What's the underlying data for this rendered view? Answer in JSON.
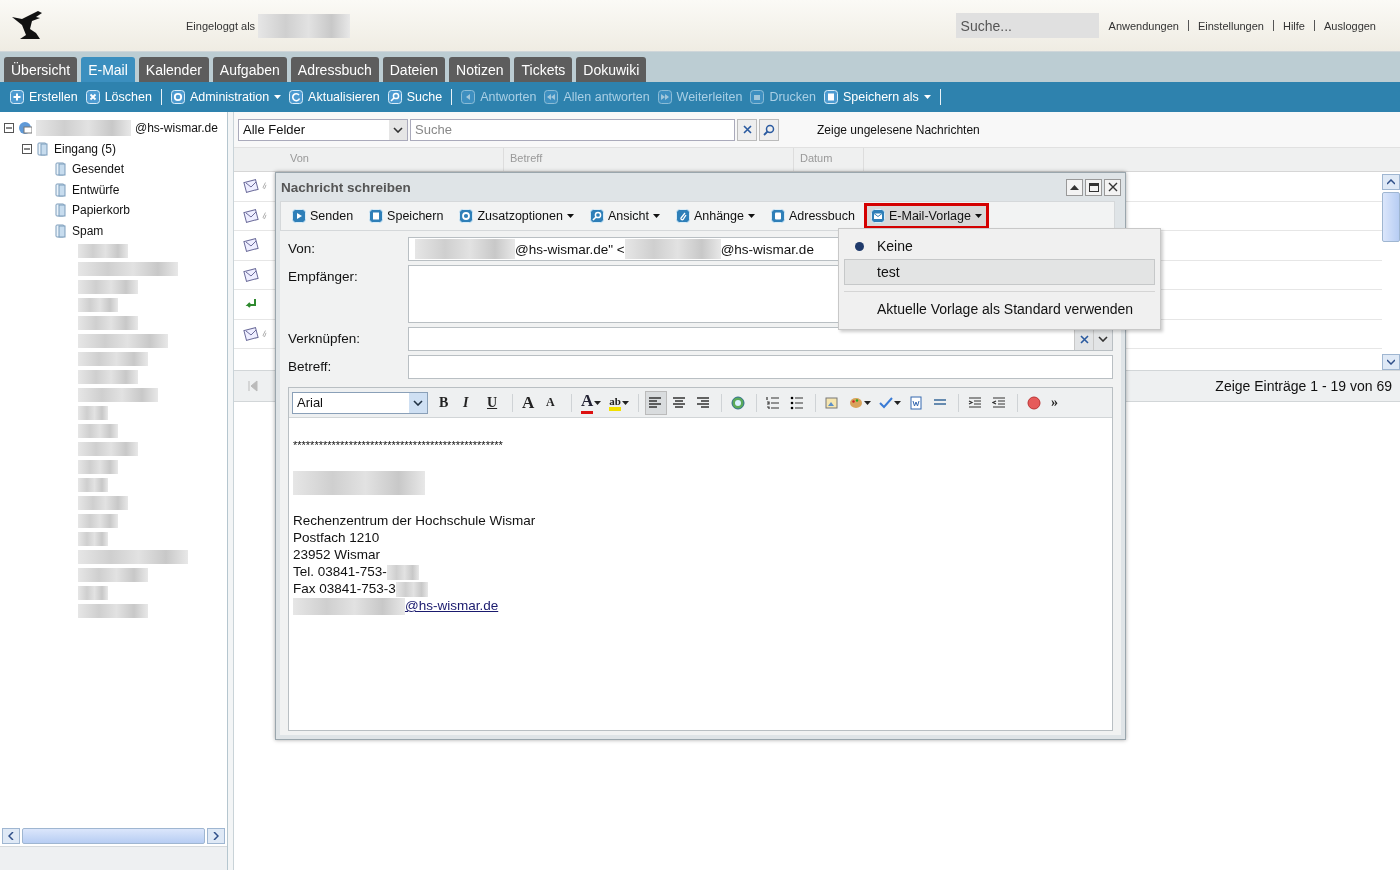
{
  "header": {
    "logged_in_label": "Eingeloggt als",
    "search": {
      "placeholder": "Suche..."
    },
    "links": [
      "Anwendungen",
      "Einstellungen",
      "Hilfe",
      "Ausloggen"
    ]
  },
  "tabs": [
    {
      "label": "Übersicht",
      "selected": false
    },
    {
      "label": "E-Mail",
      "selected": true
    },
    {
      "label": "Kalender",
      "selected": false
    },
    {
      "label": "Aufgaben",
      "selected": false
    },
    {
      "label": "Adressbuch",
      "selected": false
    },
    {
      "label": "Dateien",
      "selected": false
    },
    {
      "label": "Notizen",
      "selected": false
    },
    {
      "label": "Tickets",
      "selected": false
    },
    {
      "label": "Dokuwiki",
      "selected": false
    }
  ],
  "toolbar": {
    "groups": [
      [
        {
          "label": "Erstellen",
          "disabled": false,
          "dropdown": false
        },
        {
          "label": "Löschen",
          "disabled": false,
          "dropdown": false
        }
      ],
      [
        {
          "label": "Administration",
          "disabled": false,
          "dropdown": true
        },
        {
          "label": "Aktualisieren",
          "disabled": false,
          "dropdown": false
        },
        {
          "label": "Suche",
          "disabled": false,
          "dropdown": false
        }
      ],
      [
        {
          "label": "Antworten",
          "disabled": true,
          "dropdown": false
        },
        {
          "label": "Allen antworten",
          "disabled": true,
          "dropdown": false
        },
        {
          "label": "Weiterleiten",
          "disabled": true,
          "dropdown": false
        },
        {
          "label": "Drucken",
          "disabled": true,
          "dropdown": false
        },
        {
          "label": "Speichern als",
          "disabled": false,
          "dropdown": true
        }
      ]
    ]
  },
  "folder_tree": [
    {
      "label": "@hs-wismar.de",
      "expanded": true,
      "children": [
        {
          "label": "Eingang (5)",
          "expanded": true,
          "children": [
            {
              "label": "Gesendet"
            },
            {
              "label": "Entwürfe"
            },
            {
              "label": "Papierkorb"
            },
            {
              "label": "Spam"
            }
          ]
        }
      ]
    }
  ],
  "filter": {
    "field_select": "Alle Felder",
    "search": {
      "placeholder": "Suche"
    },
    "unread_link": "Zeige ungelesene Nachrichten"
  },
  "mail_list": {
    "columns": [
      "Von",
      "Betreff",
      "Datum"
    ],
    "rows": [
      {
        "kind": "read",
        "attachment": true
      },
      {
        "kind": "read",
        "attachment": true
      },
      {
        "kind": "read",
        "attachment": false
      },
      {
        "kind": "read",
        "attachment": false
      },
      {
        "kind": "replied",
        "attachment": false
      },
      {
        "kind": "read",
        "attachment": true
      }
    ],
    "paging": "Zeige Einträge 1 - 19 von 69"
  },
  "compose": {
    "title": "Nachricht schreiben",
    "toolbar": [
      {
        "label": "Senden",
        "dropdown": false,
        "active": false
      },
      {
        "label": "Speichern",
        "dropdown": false,
        "active": false
      },
      {
        "label": "Zusatzoptionen",
        "dropdown": true,
        "active": false
      },
      {
        "label": "Ansicht",
        "dropdown": true,
        "active": false
      },
      {
        "label": "Anhänge",
        "dropdown": true,
        "active": false
      },
      {
        "label": "Adressbuch",
        "dropdown": false,
        "active": false
      },
      {
        "label": "E-Mail-Vorlage",
        "dropdown": true,
        "active": true
      }
    ],
    "fields": [
      {
        "kind": "from",
        "label": "Von:",
        "parts": [
          "@hs-wismar.de\" <",
          "@hs-wismar.de"
        ]
      },
      {
        "kind": "area",
        "label": "Empfänger:"
      },
      {
        "kind": "combo",
        "label": "Verknüpfen:"
      },
      {
        "kind": "text",
        "label": "Betreff:"
      }
    ],
    "editor_toolbar": {
      "font": "Arial",
      "groups": [
        [
          {
            "kind": "text",
            "label": "B",
            "dropdown": false,
            "selected": false
          },
          {
            "kind": "text",
            "label": "I",
            "dropdown": false,
            "selected": false
          },
          {
            "kind": "text",
            "label": "U",
            "dropdown": false,
            "selected": false
          }
        ],
        [
          {
            "kind": "text",
            "label": "A",
            "dropdown": false,
            "selected": false
          },
          {
            "kind": "text",
            "label": "A",
            "dropdown": false,
            "selected": false
          }
        ],
        [
          {
            "kind": "text",
            "label": "A",
            "dropdown": true,
            "selected": false
          },
          {
            "kind": "text",
            "label": "ab",
            "dropdown": true,
            "selected": false
          }
        ],
        [
          {
            "kind": "icon",
            "dropdown": false,
            "selected": true
          },
          {
            "kind": "icon",
            "dropdown": false,
            "selected": false
          },
          {
            "kind": "icon",
            "dropdown": false,
            "selected": false
          }
        ],
        [
          {
            "kind": "icon",
            "dropdown": false,
            "selected": false
          }
        ],
        [
          {
            "kind": "icon",
            "dropdown": false,
            "selected": false
          },
          {
            "kind": "icon",
            "dropdown": false,
            "selected": false
          }
        ],
        [
          {
            "kind": "icon",
            "dropdown": false,
            "selected": false
          },
          {
            "kind": "icon",
            "dropdown": true,
            "selected": false
          },
          {
            "kind": "icon",
            "dropdown": true,
            "selected": false
          },
          {
            "kind": "icon",
            "dropdown": false,
            "selected": false
          },
          {
            "kind": "icon",
            "dropdown": false,
            "selected": false
          }
        ],
        [
          {
            "kind": "icon",
            "dropdown": false,
            "selected": false
          },
          {
            "kind": "icon",
            "dropdown": false,
            "selected": false
          }
        ],
        [
          {
            "kind": "icon",
            "dropdown": false,
            "selected": false
          },
          {
            "kind": "text",
            "label": "»",
            "dropdown": false,
            "selected": false
          }
        ]
      ]
    },
    "body": [
      {
        "kind": "text",
        "text": "*************************************************"
      },
      {
        "kind": "blank"
      },
      {
        "kind": "redacted"
      },
      {
        "kind": "blank"
      },
      {
        "kind": "text",
        "text": "Rechenzentrum der Hochschule Wismar"
      },
      {
        "kind": "text",
        "text": "Postfach 1210"
      },
      {
        "kind": "text",
        "text": "23952 Wismar"
      },
      {
        "kind": "text_redacted",
        "text": "Tel. 03841-753-"
      },
      {
        "kind": "text_redacted",
        "text": "Fax 03841-753-3"
      },
      {
        "kind": "redacted_link",
        "text": "@hs-wismar.de"
      }
    ],
    "template_menu": [
      {
        "label": "Keine",
        "kind": "option",
        "selected": true,
        "highlighted": false
      },
      {
        "label": "test",
        "kind": "option",
        "selected": false,
        "highlighted": true
      },
      {
        "label": "Aktuelle Vorlage als Standard verwenden",
        "kind": "action",
        "selected": false,
        "highlighted": false
      }
    ]
  }
}
